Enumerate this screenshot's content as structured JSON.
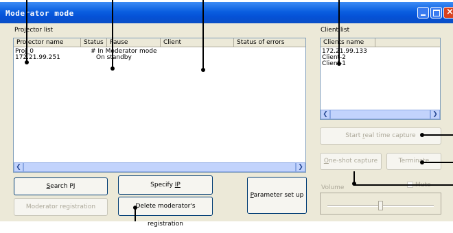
{
  "window": {
    "title": "Moderator mode"
  },
  "projector_list": {
    "label": "Projector list",
    "columns": [
      "Projector name",
      "Status",
      "Pause",
      "Client",
      "Status of errors"
    ],
    "rows": [
      {
        "name": "Proj_0",
        "status": "# In Moderator mode"
      },
      {
        "name": "172.21.99.251",
        "status": "On standby"
      }
    ]
  },
  "client_list": {
    "label": "Client list",
    "column": "Clients name",
    "items": [
      "172.21.99.133",
      "Client-2",
      "Client-1"
    ]
  },
  "buttons": {
    "search_pj_rest": "earch PJ",
    "search_pj_key": "S",
    "specify_ip_rest": "Specify ",
    "specify_ip_key": "IP",
    "moderator_registration": "Moderator registration",
    "delete_pre": "Delete moderator's registration",
    "parameter_set_up_key": "P",
    "parameter_set_up_rest": "arameter set up",
    "start_capture_pre": "Start ",
    "start_capture_key": "r",
    "start_capture_rest": "eal time capture",
    "one_shot_key": "O",
    "one_shot_rest": "ne-shot capture",
    "terminate": "Terminate"
  },
  "volume": {
    "label": "Volume",
    "mute_label": "Mute",
    "level": 0.5
  }
}
